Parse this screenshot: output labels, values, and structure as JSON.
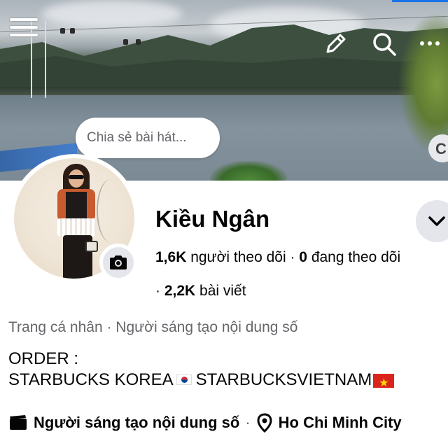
{
  "header": {
    "menu_icon": "hamburger-menu-icon",
    "edit_icon": "pencil-icon",
    "search_icon": "search-icon",
    "more_icon": "more-dots-icon"
  },
  "note": {
    "placeholder": "Chia sẻ bài hát..."
  },
  "profile": {
    "name": "Kiều Ngân",
    "followers_count": "1,6K",
    "followers_label": "người theo dõi",
    "following_count": "0",
    "following_label": "đang theo dõi",
    "posts_count": "2,2K",
    "posts_label": "bài viết",
    "category_line": "Trang cá nhân · Người sáng tạo nội dung số",
    "bio_line1": "ORDER :",
    "bio_line2_a": "STARBUCKS KOREA",
    "bio_line2_b": "STARBUCKSVIETNAM"
  },
  "info": {
    "creator_label": "Người sáng tạo nội dung số",
    "location_label": "Ho Chi Minh City"
  },
  "colors": {
    "text_primary": "#050505",
    "text_secondary": "#65676b",
    "button_bg": "#e4e6eb"
  }
}
